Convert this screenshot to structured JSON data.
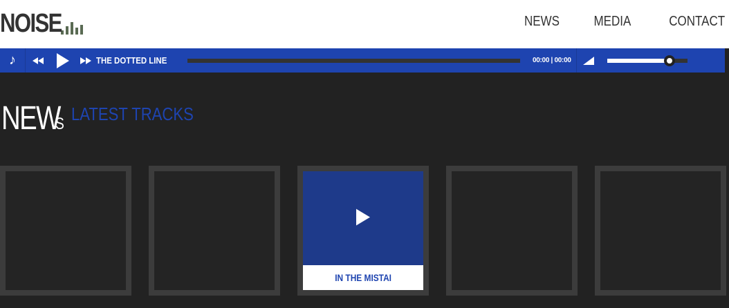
{
  "logo": {
    "text": "NOISE",
    "bar_heights": [
      6,
      12,
      18,
      10,
      14
    ]
  },
  "nav": {
    "items": [
      "NEWS",
      "MEDIA",
      "CONTACT"
    ]
  },
  "player": {
    "note_icon": "music-note-icon",
    "track_title": "THE DOTTED LINE",
    "time": "00:00 | 00:00",
    "progress": 0,
    "volume": 0.78,
    "accent": "#1e44b0"
  },
  "section": {
    "title": "NEW",
    "title_suffix": "S",
    "subtitle": "LATEST TRACKS"
  },
  "tiles": [
    {
      "caption": ""
    },
    {
      "caption": ""
    },
    {
      "caption": "IN THE MISTAI",
      "active": true
    },
    {
      "caption": ""
    },
    {
      "caption": ""
    }
  ]
}
